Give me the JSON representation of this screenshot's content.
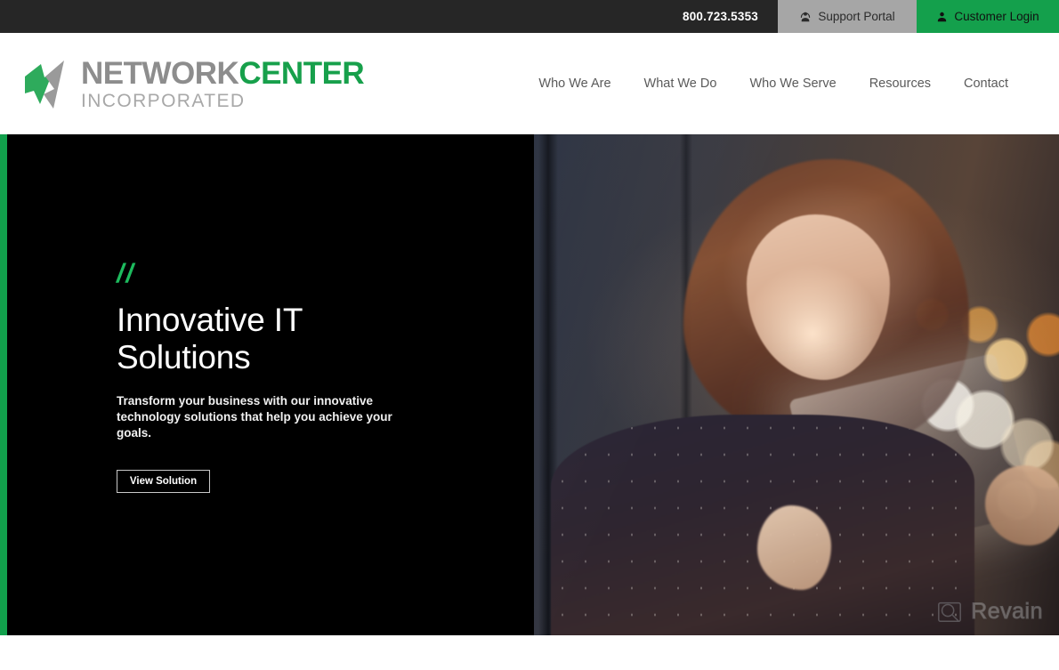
{
  "topbar": {
    "phone": "800.723.5353",
    "support_label": "Support Portal",
    "support_icon": "support-agent-icon",
    "login_label": "Customer Login",
    "login_icon": "user-icon",
    "bg_color": "#262626",
    "support_bg": "#a6a6a6",
    "login_bg": "#14a04c"
  },
  "header": {
    "logo": {
      "mark": "checkmark-arrow-icon",
      "line1_part1": "NETWORK",
      "line1_part2": "CENTER",
      "line2": "INCORPORATED",
      "gray": "#8d8d8d",
      "green": "#17a04b"
    },
    "nav": [
      {
        "label": "Who We Are"
      },
      {
        "label": "What We Do"
      },
      {
        "label": "Who We Serve"
      },
      {
        "label": "Resources"
      },
      {
        "label": "Contact"
      }
    ]
  },
  "hero": {
    "accent_bar_color": "#12a04c",
    "eyebrow": "//",
    "title": "Innovative IT Solutions",
    "subtitle": "Transform your business with our innovative technology solutions that help you achieve your goals.",
    "cta_label": "View Solution",
    "image_alt": "Woman with auburn hair holding a glowing tablet at night with city bokeh lights"
  },
  "watermark": {
    "text": "Revain",
    "icon": "magnifier-photo-icon"
  }
}
